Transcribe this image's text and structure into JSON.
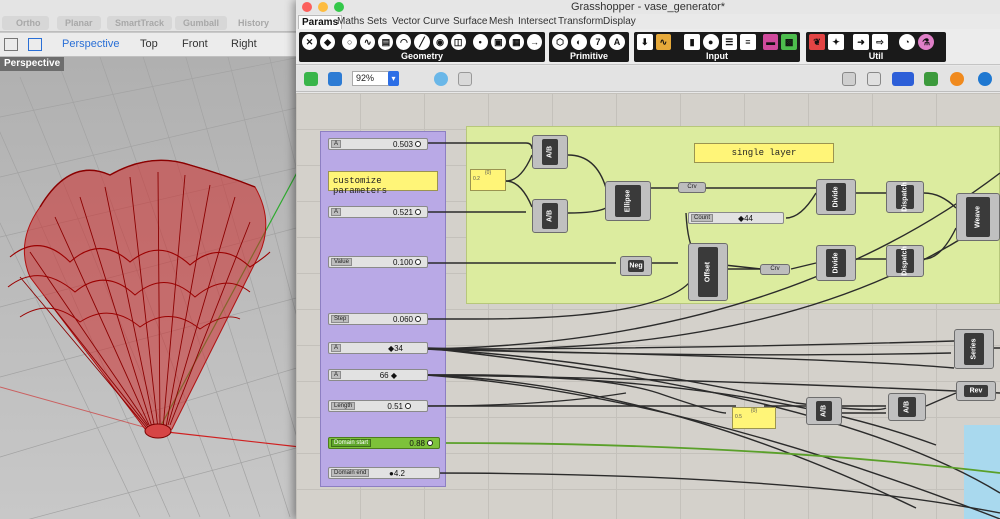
{
  "rhino": {
    "snap_buttons": [
      "Ortho",
      "Planar",
      "SmartTrack",
      "Gumball"
    ],
    "history_label": "History",
    "view_tabs": [
      "Perspective",
      "Top",
      "Front",
      "Right"
    ],
    "viewport_label": "Perspective"
  },
  "grasshopper": {
    "window_title": "Grasshopper - vase_generator*",
    "menu_tabs": [
      "Params",
      "Maths",
      "Sets",
      "Vector",
      "Curve",
      "Surface",
      "Mesh",
      "Intersect",
      "Transform",
      "Display"
    ],
    "ribbon_groups": [
      "Geometry",
      "Primitive",
      "Input",
      "Util"
    ],
    "zoom_level": "92%",
    "canvas": {
      "panels": {
        "customize": "customize parameters",
        "single_layer": "single layer",
        "small_a_header": "{0}",
        "small_a_value": "0.2",
        "small_b_header": "{0}",
        "small_b_value": "0.5"
      },
      "sliders": [
        {
          "tag": "A",
          "value": "0.503",
          "marker": "●"
        },
        {
          "tag": "A",
          "value": "0.521",
          "marker": "●"
        },
        {
          "tag": "Value",
          "value": "0.100",
          "marker": "●"
        },
        {
          "tag": "Step",
          "value": "0.060",
          "marker": "●"
        },
        {
          "tag": "A",
          "value": "◆34",
          "marker": ""
        },
        {
          "tag": "A",
          "value": "66 ◆",
          "marker": ""
        },
        {
          "tag": "Length",
          "value": "0.51",
          "marker": "●"
        },
        {
          "tag": "Domain start",
          "value": "0.88",
          "marker": "●"
        },
        {
          "tag": "Domain end",
          "value": "●4.2",
          "marker": ""
        }
      ],
      "count_slider": {
        "tag": "Count",
        "value": "◆44"
      },
      "components": {
        "div1": "A/B",
        "div2": "A/B",
        "div3": "A/B",
        "div4": "A/B",
        "ellipse": "Ellipse",
        "offset": "Offset",
        "divide1": "Divide",
        "divide2": "Divide",
        "dispatch1": "Dispatch",
        "dispatch2": "Dispatch",
        "weave": "Weave",
        "series": "Series",
        "neg": "Neg",
        "rev": "Rev"
      },
      "params": {
        "crv1": "Crv",
        "crv2": "Crv"
      }
    }
  }
}
